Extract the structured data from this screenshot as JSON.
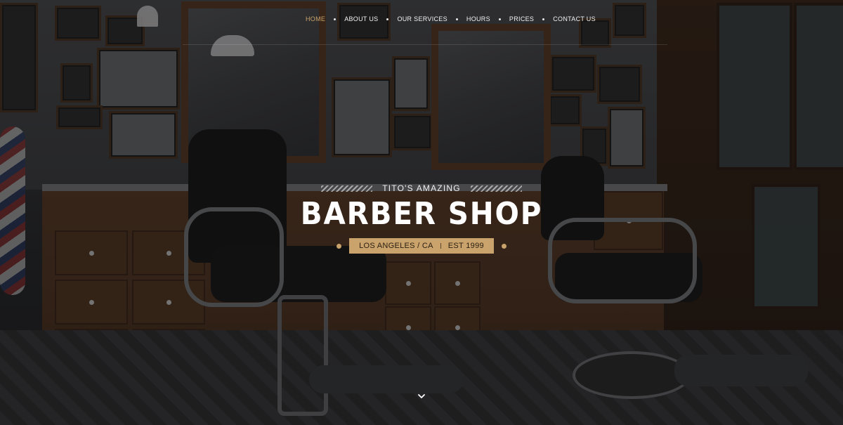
{
  "nav": {
    "items": [
      {
        "label": "HOME",
        "active": true
      },
      {
        "label": "ABOUT US",
        "active": false
      },
      {
        "label": "OUR SERVICES",
        "active": false
      },
      {
        "label": "HOURS",
        "active": false
      },
      {
        "label": "PRICES",
        "active": false
      },
      {
        "label": "CONTACT US",
        "active": false
      }
    ]
  },
  "hero": {
    "pretitle": "TITO'S AMAZING",
    "title": "BARBER SHOP",
    "location": "LOS ANGELES / CA",
    "established": "EST 1999",
    "scroll_icon": "chevron-down-icon"
  },
  "colors": {
    "accent": "#c9a36b",
    "text": "#ffffff",
    "overlay": "#0a0a0c"
  },
  "background": {
    "description_icon": "barbershop-photo"
  }
}
